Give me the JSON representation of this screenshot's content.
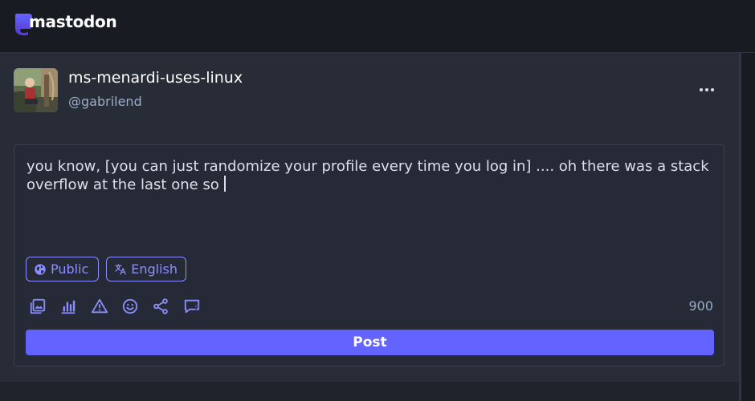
{
  "app": {
    "logo_text": "mastodon"
  },
  "account": {
    "display_name": "ms-menardi-uses-linux",
    "handle": "@gabrilend",
    "avatar": "avatar-photo"
  },
  "menu": {
    "icon": "ellipsis-icon"
  },
  "compose": {
    "text": "you know, [you can just randomize your profile every time you log in] .... oh there was a stack overflow at the last one so",
    "visibility_label": "Public",
    "language_label": "English",
    "char_counter": "900",
    "post_label": "Post",
    "toolbar_icons": [
      "media-icon",
      "poll-icon",
      "content-warning-icon",
      "emoji-icon",
      "quote-icon",
      "interaction-policy-icon"
    ]
  },
  "colors": {
    "accent": "#6364ff",
    "accent_text": "#8c8dff",
    "panel_bg": "#282c37",
    "page_bg": "#191b22",
    "muted_text": "#9baec8"
  }
}
